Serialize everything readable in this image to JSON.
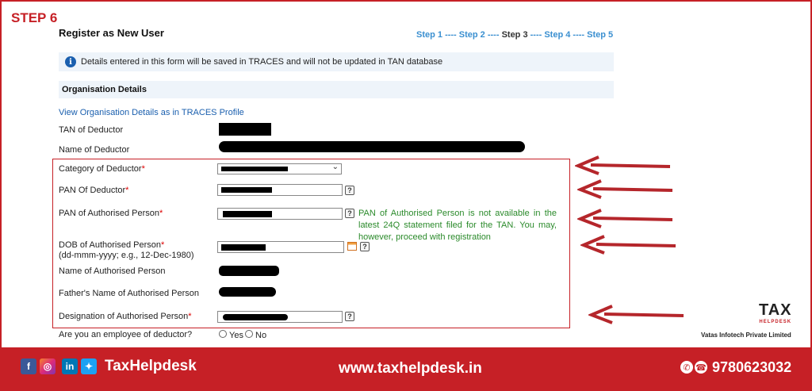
{
  "step_tag": "STEP 6",
  "form": {
    "title": "Register as New User",
    "steps": {
      "s1": "Step 1",
      "sep": " ---- ",
      "s2": "Step 2",
      "s3": "Step 3",
      "s4": "Step 4",
      "s5": "Step 5",
      "current": "Step 3"
    },
    "info": "Details entered in this form will be saved in TRACES and will not be updated in TAN database",
    "section": "Organisation Details",
    "profile_link": "View Organisation Details as in TRACES Profile",
    "fields": {
      "tan": "TAN of Deductor",
      "name": "Name of Deductor",
      "category": "Category of Deductor",
      "pan": "PAN Of Deductor",
      "pan_auth": "PAN of Authorised Person",
      "dob": "DOB of Authorised Person",
      "dob_format": "(dd-mmm-yyyy; e.g., 12-Dec-1980)",
      "name_auth": "Name of Authorised Person",
      "father": "Father's Name of Authorised Person",
      "designation": "Designation of Authorised Person",
      "employee": "Are you an employee of deductor?"
    },
    "required_mark": "*",
    "help_glyph": "?",
    "pan_note": "PAN of Authorised Person is not available in the latest 24Q statement filed for the TAN. You may, however, proceed with registration",
    "radio": {
      "yes": "Yes",
      "no": "No"
    }
  },
  "branding": {
    "logo": "TAX",
    "logo_sub": "HELPDESK",
    "company": "Vatas Infotech Private Limited"
  },
  "footer": {
    "brand": "TaxHelpdesk",
    "website": "www.taxhelpdesk.in",
    "phone": "9780623032",
    "social": [
      "facebook-icon",
      "instagram-icon",
      "linkedin-icon",
      "twitter-icon"
    ]
  },
  "colors": {
    "accent": "#c62026",
    "link": "#1a5fae",
    "note": "#2a8a2a"
  }
}
